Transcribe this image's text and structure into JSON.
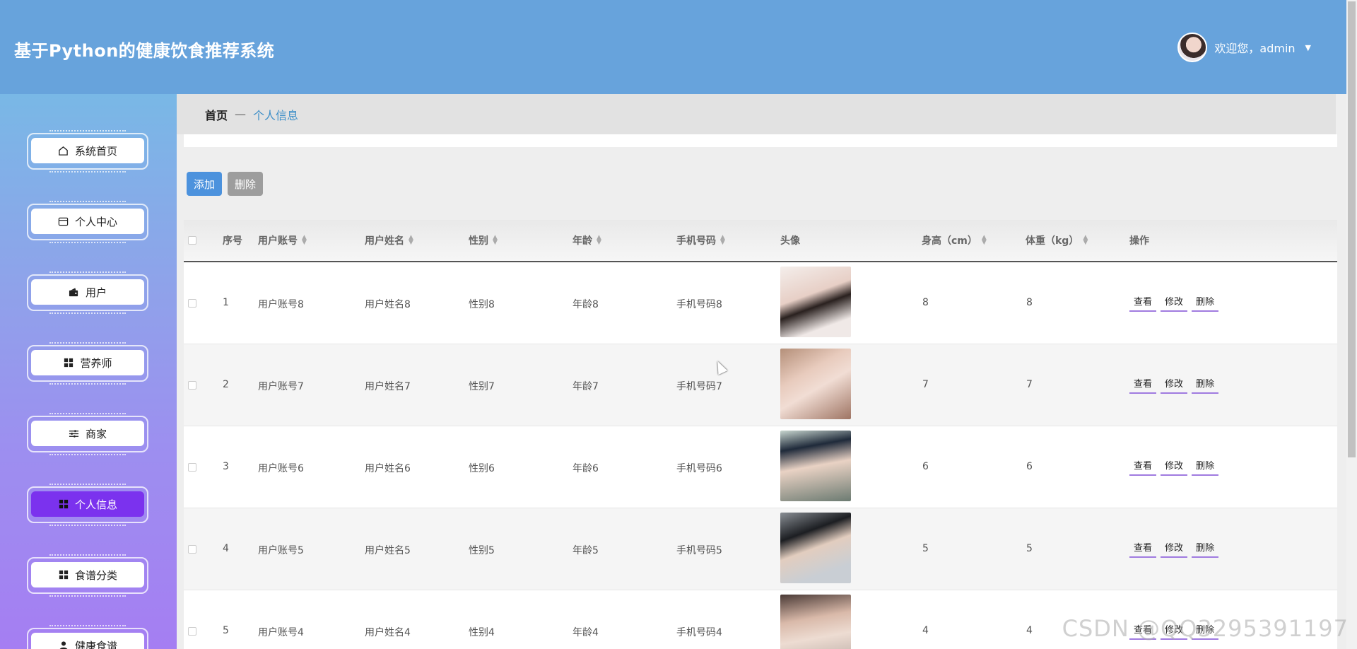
{
  "header": {
    "app_title": "基于Python的健康饮食推荐系统",
    "welcome": "欢迎您，admin",
    "dropdown_icon": "caret-down-icon"
  },
  "sidebar": {
    "items": [
      {
        "label": "系统首页",
        "icon": "home-icon"
      },
      {
        "label": "个人中心",
        "icon": "card-icon"
      },
      {
        "label": "用户",
        "icon": "wallet-icon"
      },
      {
        "label": "营养师",
        "icon": "grid-icon"
      },
      {
        "label": "商家",
        "icon": "sliders-icon"
      },
      {
        "label": "个人信息",
        "icon": "grid-icon",
        "active": true
      },
      {
        "label": "食谱分类",
        "icon": "grid-icon"
      },
      {
        "label": "健康食谱",
        "icon": "user-icon"
      }
    ]
  },
  "breadcrumb": {
    "home": "首页",
    "separator": "—",
    "current": "个人信息"
  },
  "actions": {
    "add": "添加",
    "delete": "删除"
  },
  "table": {
    "headers": [
      "序号",
      "用户账号",
      "用户姓名",
      "性别",
      "年龄",
      "手机号码",
      "头像",
      "身高（cm）",
      "体重（kg）",
      "操作"
    ],
    "op_labels": {
      "view": "查看",
      "edit": "修改",
      "delete": "删除"
    },
    "rows": [
      {
        "index": "1",
        "account": "用户账号8",
        "name": "用户姓名8",
        "gender": "性别8",
        "age": "年龄8",
        "phone": "手机号码8",
        "height": "8",
        "weight": "8"
      },
      {
        "index": "2",
        "account": "用户账号7",
        "name": "用户姓名7",
        "gender": "性别7",
        "age": "年龄7",
        "phone": "手机号码7",
        "height": "7",
        "weight": "7"
      },
      {
        "index": "3",
        "account": "用户账号6",
        "name": "用户姓名6",
        "gender": "性别6",
        "age": "年龄6",
        "phone": "手机号码6",
        "height": "6",
        "weight": "6"
      },
      {
        "index": "4",
        "account": "用户账号5",
        "name": "用户姓名5",
        "gender": "性别5",
        "age": "年龄5",
        "phone": "手机号码5",
        "height": "5",
        "weight": "5"
      },
      {
        "index": "5",
        "account": "用户账号4",
        "name": "用户姓名4",
        "gender": "性别4",
        "age": "年龄4",
        "phone": "手机号码4",
        "height": "4",
        "weight": "4"
      }
    ]
  },
  "watermark": "CSDN @QQ3295391197",
  "colors": {
    "header": "#67a3dc",
    "active_menu": "#7b32ee",
    "add_button": "#4c92dd",
    "delete_button": "#9d9d9d",
    "link_underline": "#a07be0"
  }
}
